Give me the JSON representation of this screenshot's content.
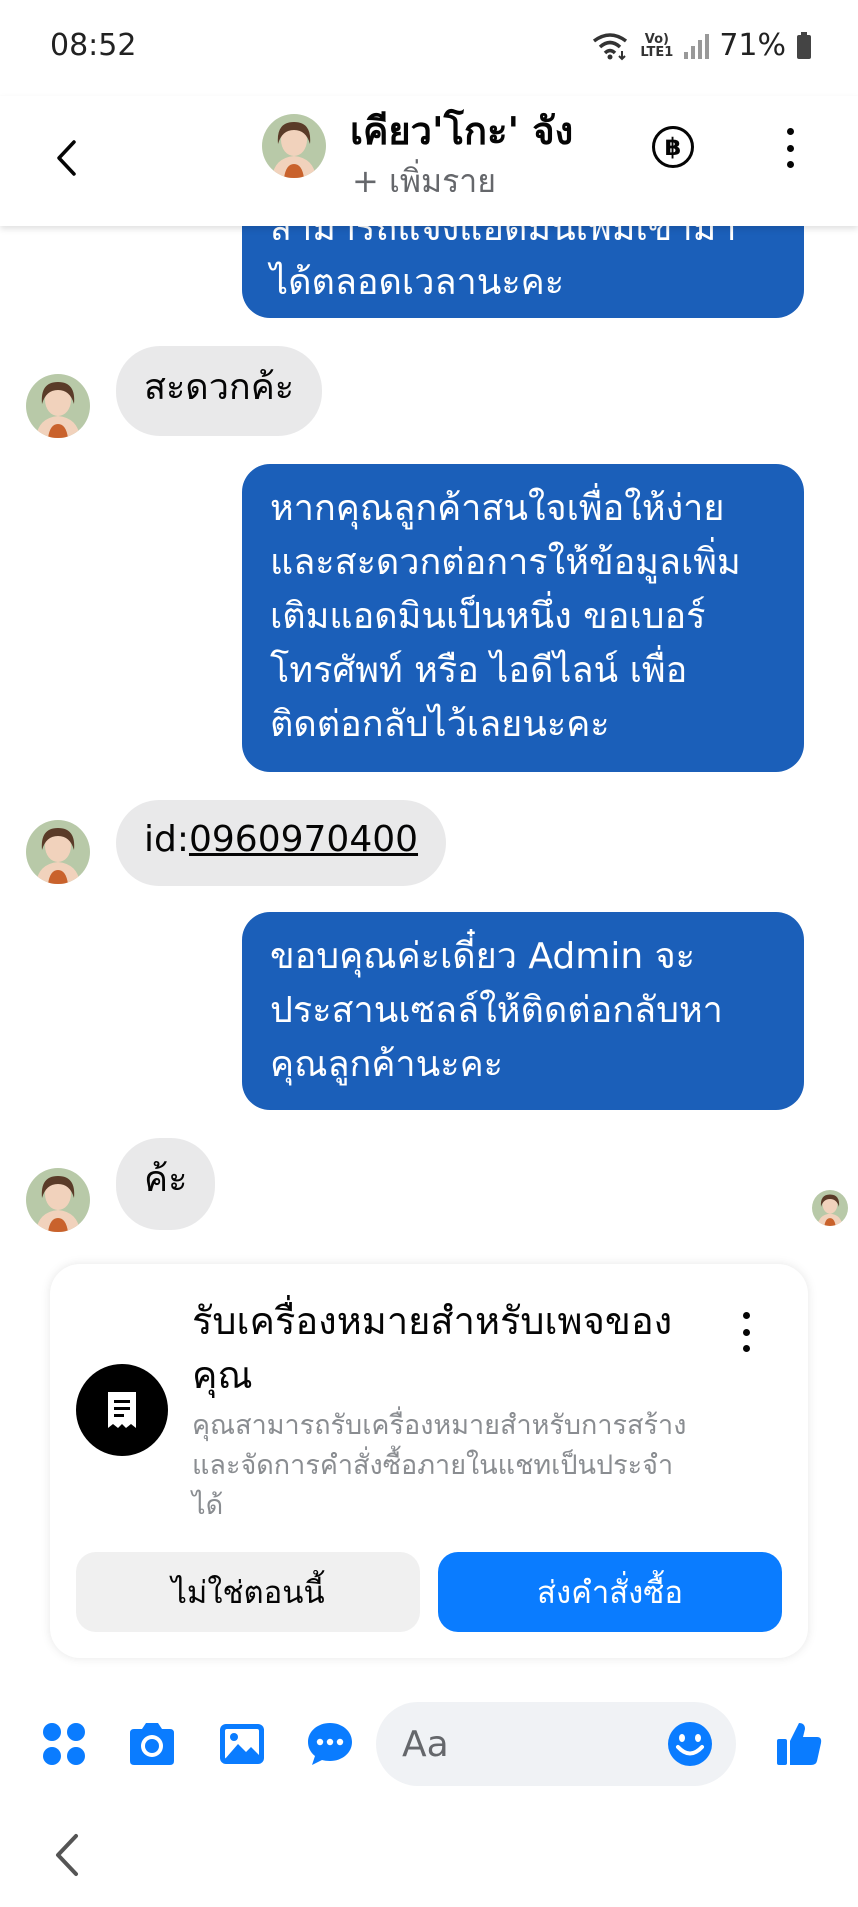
{
  "status": {
    "time": "08:52",
    "network_top": "Vo)",
    "network_bottom": "LTE1",
    "battery": "71%"
  },
  "header": {
    "name": "เคียว'โกะ' จัง",
    "subtitle": "+ เพิ่มราย",
    "currency_symbol": "฿"
  },
  "messages": {
    "m1_partial": "สามารถแจ้งแอดมินเพิ่มเข้ามา",
    "m1_last": "ได้ตลอดเวลานะคะ",
    "m2": "สะดวกค้ะ",
    "m3": [
      "หากคุณลูกค้าสนใจเพื่อให้ง่าย",
      "และสะดวกต่อการให้ข้อมูลเพิ่ม",
      "เติมแอดมินเป็นหนึ่ง ขอเบอร์",
      "โทรศัพท์ หรือ ไอดีไลน์ เพื่อ",
      "ติดต่อกลับไว้เลยนะคะ"
    ],
    "m4_prefix": "id:",
    "m4_link": "0960970400",
    "m5": [
      "ขอบคุณค่ะเดี๋ยว Admin จะ",
      "ประสานเซลล์ให้ติดต่อกลับหา",
      "คุณลูกค้านะคะ"
    ],
    "m6": "ค้ะ"
  },
  "card": {
    "title": "รับเครื่องหมายสำหรับเพจของคุณ",
    "description": "คุณสามารถรับเครื่องหมายสำหรับการสร้างและจัดการคำสั่งซื้อภายในแชทเป็นประจำได้",
    "secondary_label": "ไม่ใช่ตอนนี้",
    "primary_label": "ส่งคำสั่งซื้อ",
    "icon": "receipt-icon"
  },
  "composer": {
    "placeholder": "Aa",
    "icons": [
      "apps-icon",
      "camera-icon",
      "gallery-icon",
      "chat-bubble-icon",
      "emoji-icon",
      "thumbs-up-icon"
    ]
  },
  "colors": {
    "outgoing_bubble": "#1b5fb9",
    "incoming_bubble": "#e9e9ea",
    "accent": "#0a7cff"
  }
}
